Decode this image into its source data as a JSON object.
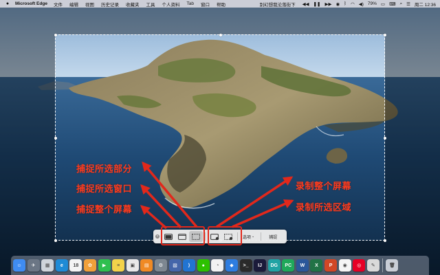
{
  "menubar": {
    "app_name": "Microsoft Edge",
    "menus": [
      "文件",
      "编辑",
      "视图",
      "历史记录",
      "收藏夹",
      "工具",
      "个人资料",
      "Tab",
      "窗口",
      "帮助"
    ],
    "now_playing": "别幻想我沦落街下",
    "battery": "79%",
    "clock": "周二 12:36"
  },
  "annotations": {
    "capture_selected": "捕捉所选部分",
    "capture_window": "捕捉所选窗口",
    "capture_screen": "捕捉整个屏幕",
    "record_screen": "录制整个屏幕",
    "record_selected": "录制所选区域"
  },
  "toolbar": {
    "options_label": "选项",
    "capture_label": "捕捉"
  },
  "colors": {
    "annotation": "#ff3b1d",
    "highlight_box": "#e2281b"
  },
  "dock": {
    "icons": [
      {
        "name": "finder-icon",
        "glyph": "☺",
        "color": "#3f8cf2"
      },
      {
        "name": "launchpad-icon",
        "glyph": "✈",
        "color": "#6b7685"
      },
      {
        "name": "photos-slides-icon",
        "glyph": "▦",
        "color": "#cfd4da"
      },
      {
        "name": "edge-icon",
        "glyph": "e",
        "color": "#1f8bd6"
      },
      {
        "name": "calendar-icon",
        "glyph": "18",
        "color": "#f4f4f4"
      },
      {
        "name": "photos-icon",
        "glyph": "✿",
        "color": "#f0a03a"
      },
      {
        "name": "facetime-icon",
        "glyph": "▶",
        "color": "#2fbf4f"
      },
      {
        "name": "notes-icon",
        "glyph": "≡",
        "color": "#f3d34a"
      },
      {
        "name": "preview-icon",
        "glyph": "▣",
        "color": "#e8e8e8"
      },
      {
        "name": "books-icon",
        "glyph": "▤",
        "color": "#f08a24"
      },
      {
        "name": "system-preferences-icon",
        "glyph": "⚙",
        "color": "#7d8791"
      },
      {
        "name": "image-viewer-icon",
        "glyph": "▧",
        "color": "#4466aa"
      },
      {
        "name": "vscode-icon",
        "glyph": "⟩",
        "color": "#2274d1"
      },
      {
        "name": "wechat-icon",
        "glyph": "●",
        "color": "#2dc100"
      },
      {
        "name": "qq-icon",
        "glyph": "◔",
        "color": "#f2f2f2"
      },
      {
        "name": "fuchsia-app-icon",
        "glyph": "◆",
        "color": "#2e7de0"
      },
      {
        "name": "terminal-icon",
        "glyph": ">_",
        "color": "#2a2a2a"
      },
      {
        "name": "intellij-icon",
        "glyph": "IJ",
        "color": "#1b1b3a"
      },
      {
        "name": "datagrip-icon",
        "glyph": "DG",
        "color": "#21a3a4"
      },
      {
        "name": "pycharm-icon",
        "glyph": "PC",
        "color": "#1fa85a"
      },
      {
        "name": "word-icon",
        "glyph": "W",
        "color": "#2b579a"
      },
      {
        "name": "excel-icon",
        "glyph": "X",
        "color": "#217346"
      },
      {
        "name": "powerpoint-icon",
        "glyph": "P",
        "color": "#d24726"
      },
      {
        "name": "music-app-icon",
        "glyph": "◉",
        "color": "#f5f5f5"
      },
      {
        "name": "netease-music-icon",
        "glyph": "◎",
        "color": "#e60026"
      },
      {
        "name": "appcleaner-icon",
        "glyph": "✎",
        "color": "#d9d9d9"
      },
      {
        "name": "trash-icon",
        "glyph": "🗑",
        "color": "#c9ced6"
      }
    ]
  }
}
